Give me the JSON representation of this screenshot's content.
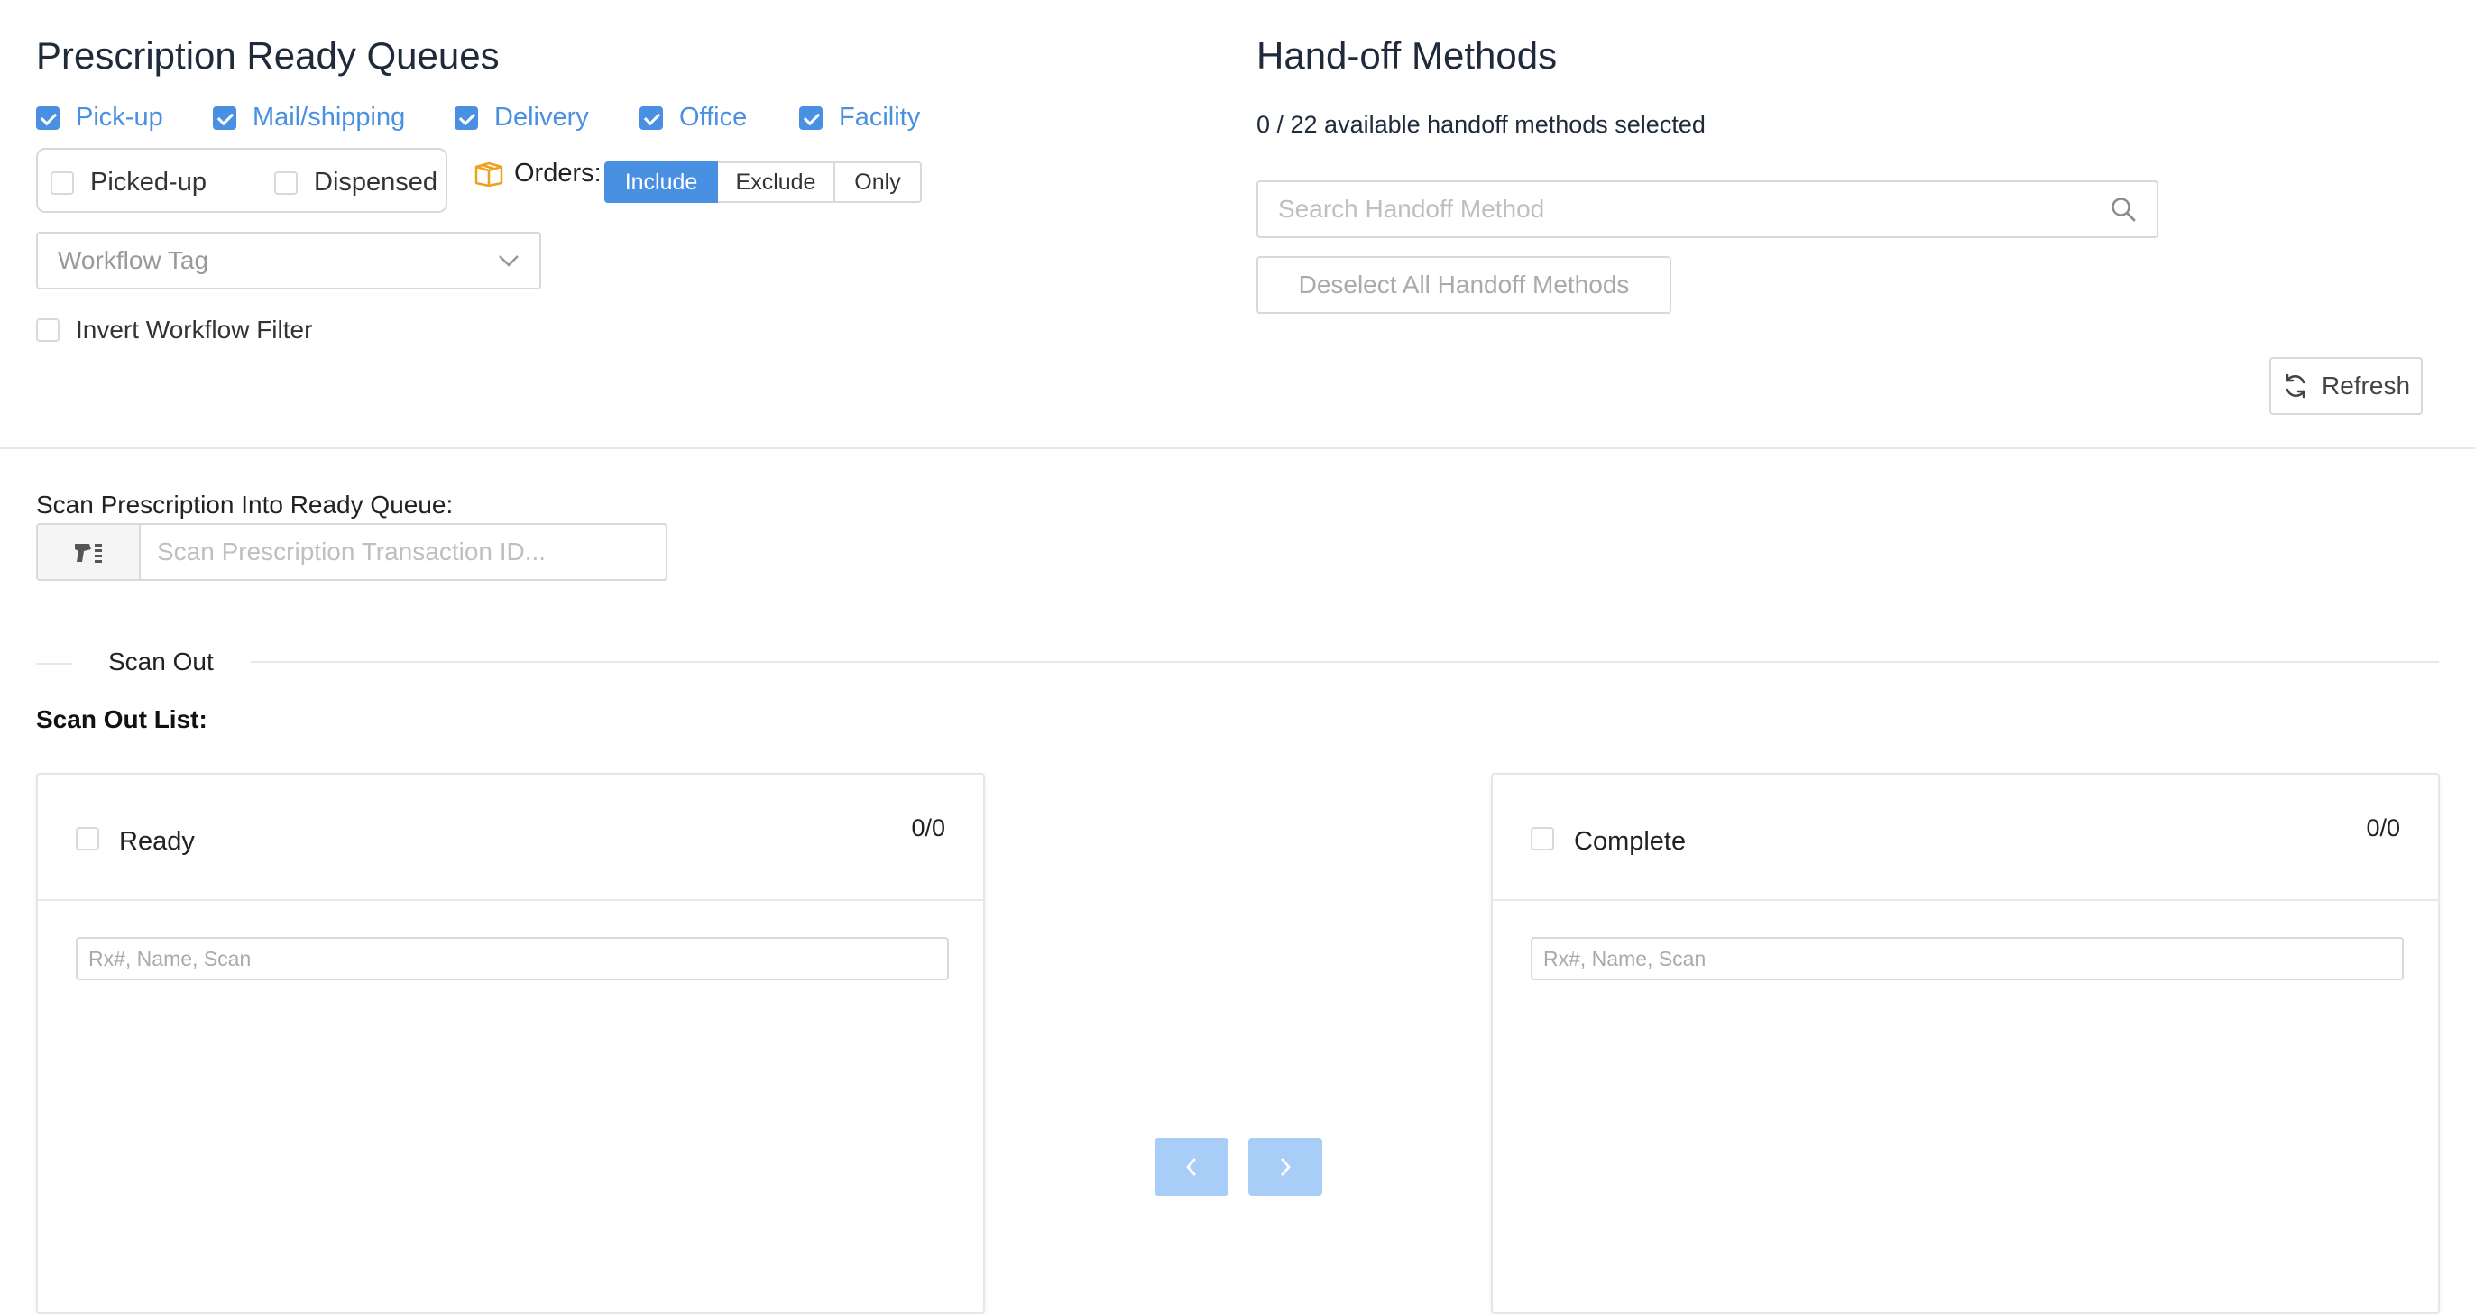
{
  "queues": {
    "title": "Prescription Ready Queues",
    "items": [
      {
        "label": "Pick-up",
        "checked": true
      },
      {
        "label": "Mail/shipping",
        "checked": true
      },
      {
        "label": "Delivery",
        "checked": true
      },
      {
        "label": "Office",
        "checked": true
      },
      {
        "label": "Facility",
        "checked": true
      }
    ],
    "status_filters": [
      {
        "label": "Picked-up",
        "checked": false
      },
      {
        "label": "Dispensed",
        "checked": false
      }
    ],
    "orders_label": "Orders:",
    "orders_options": [
      "Include",
      "Exclude",
      "Only"
    ],
    "orders_selected": "Include",
    "workflow_tag_placeholder": "Workflow Tag",
    "invert_label": "Invert Workflow Filter"
  },
  "handoff": {
    "title": "Hand-off Methods",
    "summary": "0 / 22 available handoff methods selected",
    "search_placeholder": "Search Handoff Method",
    "deselect_label": "Deselect All Handoff Methods"
  },
  "refresh_label": "Refresh",
  "scan_in": {
    "label": "Scan Prescription Into Ready Queue:",
    "placeholder": "Scan Prescription Transaction ID..."
  },
  "scan_out": {
    "divider_label": "Scan Out",
    "list_label": "Scan Out List:",
    "ready": {
      "title": "Ready",
      "count": "0/0",
      "search_placeholder": "Rx#, Name, Scan"
    },
    "complete": {
      "title": "Complete",
      "count": "0/0",
      "search_placeholder": "Rx#, Name, Scan"
    }
  },
  "colors": {
    "accent": "#4a90e2",
    "accent_disabled": "#a8cdf7",
    "icon_orange": "#f0a020"
  }
}
